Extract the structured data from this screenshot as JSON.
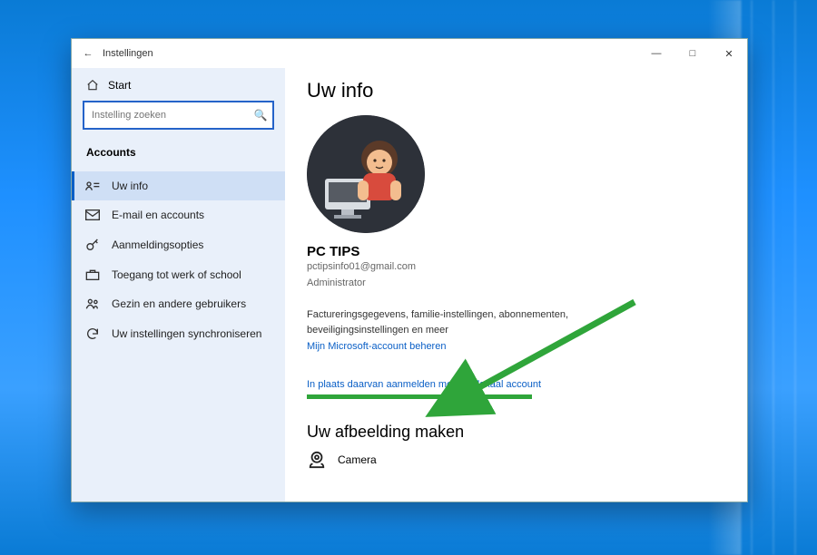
{
  "titlebar": {
    "label": "Instellingen"
  },
  "home": {
    "label": "Start"
  },
  "search": {
    "placeholder": "Instelling zoeken"
  },
  "category": {
    "label": "Accounts"
  },
  "nav": {
    "items": [
      {
        "label": "Uw info"
      },
      {
        "label": "E-mail en accounts"
      },
      {
        "label": "Aanmeldingsopties"
      },
      {
        "label": "Toegang tot werk of school"
      },
      {
        "label": "Gezin en andere gebruikers"
      },
      {
        "label": "Uw instellingen synchroniseren"
      }
    ]
  },
  "main": {
    "heading": "Uw info",
    "username": "PC TIPS",
    "email": "pctipsinfo01@gmail.com",
    "role": "Administrator",
    "billing_text": "Factureringsgegevens, familie-instellingen, abonnementen, beveiligingsinstellingen en meer",
    "manage_link": "Mijn Microsoft-account beheren",
    "local_link": "In plaats daarvan aanmelden met een lokaal account",
    "picture_heading": "Uw afbeelding maken",
    "camera_label": "Camera"
  }
}
